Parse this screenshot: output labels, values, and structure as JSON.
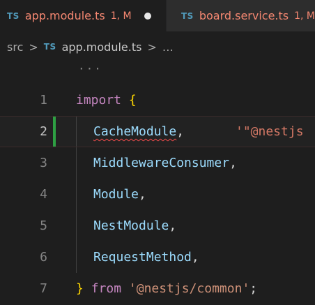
{
  "tabs": [
    {
      "badge": "TS",
      "name": "app.module.ts",
      "status": "1, M",
      "dirty": true
    },
    {
      "badge": "TS",
      "name": "board.service.ts",
      "status": "1, M"
    }
  ],
  "breadcrumb": {
    "folder": "src",
    "sep": ">",
    "badge": "TS",
    "file": "app.module.ts",
    "ellipsis": "…"
  },
  "editor": {
    "folded_marker": "···",
    "lines": [
      {
        "number": "1",
        "keyword": "import",
        "brace": "{"
      },
      {
        "number": "2",
        "ident": "CacheModule",
        "punct": ",",
        "hint": "'\"@nestjs"
      },
      {
        "number": "3",
        "ident": "MiddlewareConsumer",
        "punct": ","
      },
      {
        "number": "4",
        "ident": "Module",
        "punct": ","
      },
      {
        "number": "5",
        "ident": "NestModule",
        "punct": ","
      },
      {
        "number": "6",
        "ident": "RequestMethod",
        "punct": ","
      },
      {
        "number": "7",
        "brace": "}",
        "keyword": "from",
        "string": "'@nestjs/common'",
        "punct": ";"
      }
    ]
  },
  "colors": {
    "background": "#1e1e1e",
    "tab_error_text": "#f48771",
    "ts_badge": "#519aba",
    "keyword": "#c586c0",
    "brace": "#ffd700",
    "identifier": "#9cdcfe",
    "string": "#ce9178",
    "git_modified_gutter": "#2ea043",
    "error_squiggle": "#f14c4c"
  }
}
